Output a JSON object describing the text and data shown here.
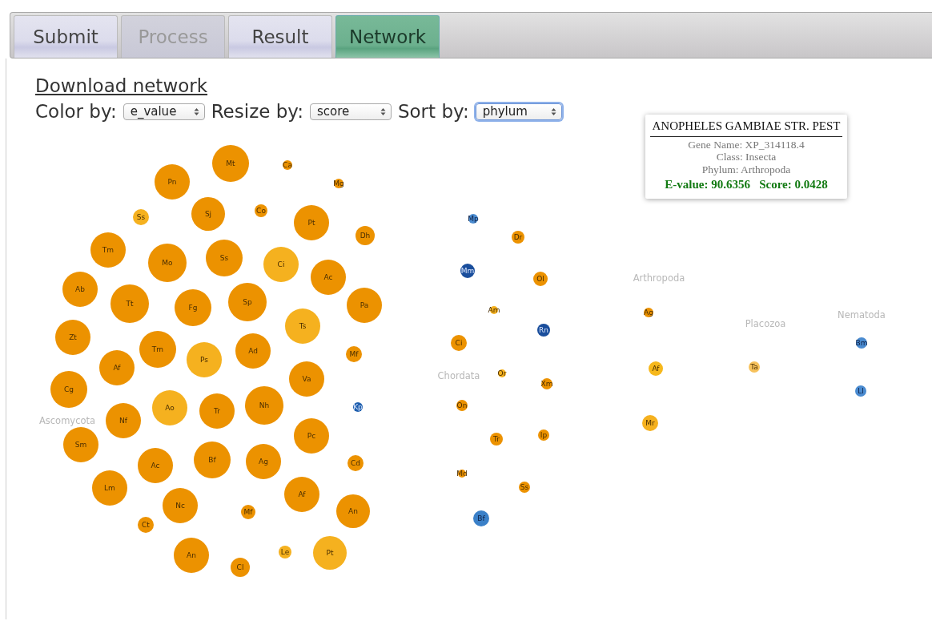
{
  "tabs": [
    {
      "label": "Submit",
      "selected": false,
      "disabled": false
    },
    {
      "label": "Process",
      "selected": false,
      "disabled": true
    },
    {
      "label": "Result",
      "selected": false,
      "disabled": false
    },
    {
      "label": "Network",
      "selected": true,
      "disabled": false
    }
  ],
  "download_link": "Download network",
  "controls": [
    {
      "label": "Color by:",
      "value": "e_value",
      "focused": false
    },
    {
      "label": "Resize by:",
      "value": "score",
      "focused": false
    },
    {
      "label": "Sort by:",
      "value": "phylum",
      "focused": true
    }
  ],
  "groups": [
    {
      "label": "Ascomycota"
    },
    {
      "label": "Chordata"
    },
    {
      "label": "Arthropoda"
    },
    {
      "label": "Placozoa"
    },
    {
      "label": "Nematoda"
    }
  ],
  "nodes": [
    {
      "label": "Mt",
      "color": "#ec9200"
    },
    {
      "label": "Pn",
      "color": "#ec9200"
    },
    {
      "label": "Ca",
      "color": "#ec9200"
    },
    {
      "label": "Mg",
      "color": "#ec9200"
    },
    {
      "label": "Ss",
      "color": "#f5b11f"
    },
    {
      "label": "Sj",
      "color": "#ec9200"
    },
    {
      "label": "Co",
      "color": "#ec9200"
    },
    {
      "label": "Pt",
      "color": "#ec9200"
    },
    {
      "label": "Dh",
      "color": "#ec9200"
    },
    {
      "label": "Tm",
      "color": "#ec9200"
    },
    {
      "label": "Mo",
      "color": "#ec9200"
    },
    {
      "label": "Ss",
      "color": "#ec9200"
    },
    {
      "label": "Ci",
      "color": "#f5b11f"
    },
    {
      "label": "Ac",
      "color": "#ec9200"
    },
    {
      "label": "Ab",
      "color": "#ec9200"
    },
    {
      "label": "Tt",
      "color": "#ec9200"
    },
    {
      "label": "Fg",
      "color": "#ec9200"
    },
    {
      "label": "Sp",
      "color": "#ec9200"
    },
    {
      "label": "Pa",
      "color": "#ec9200"
    },
    {
      "label": "Ts",
      "color": "#f5b11f"
    },
    {
      "label": "Zt",
      "color": "#ec9200"
    },
    {
      "label": "Tm",
      "color": "#ec9200"
    },
    {
      "label": "Ps",
      "color": "#f5b11f"
    },
    {
      "label": "Ad",
      "color": "#ec9200"
    },
    {
      "label": "Mf",
      "color": "#ec9200"
    },
    {
      "label": "Af",
      "color": "#ec9200"
    },
    {
      "label": "Va",
      "color": "#ec9200"
    },
    {
      "label": "Cg",
      "color": "#ec9200"
    },
    {
      "label": "Ao",
      "color": "#f5b11f"
    },
    {
      "label": "Tr",
      "color": "#ec9200"
    },
    {
      "label": "Nh",
      "color": "#ec9200"
    },
    {
      "label": "Kp",
      "color": "#1f5fae"
    },
    {
      "label": "Nf",
      "color": "#ec9200"
    },
    {
      "label": "Pc",
      "color": "#ec9200"
    },
    {
      "label": "Sm",
      "color": "#ec9200"
    },
    {
      "label": "Ac",
      "color": "#ec9200"
    },
    {
      "label": "Bf",
      "color": "#ec9200"
    },
    {
      "label": "Ag",
      "color": "#ec9200"
    },
    {
      "label": "Cd",
      "color": "#ec9200"
    },
    {
      "label": "Lm",
      "color": "#ec9200"
    },
    {
      "label": "Af",
      "color": "#ec9200"
    },
    {
      "label": "Nc",
      "color": "#ec9200"
    },
    {
      "label": "Mf",
      "color": "#ec9200"
    },
    {
      "label": "An",
      "color": "#ec9200"
    },
    {
      "label": "Ct",
      "color": "#ec9200"
    },
    {
      "label": "An",
      "color": "#ec9200"
    },
    {
      "label": "Le",
      "color": "#f5b11f"
    },
    {
      "label": "Pt",
      "color": "#f5b11f"
    },
    {
      "label": "Cl",
      "color": "#ec9200"
    },
    {
      "label": "Mp",
      "color": "#4a8bd0"
    },
    {
      "label": "Dr",
      "color": "#ec9200"
    },
    {
      "label": "Mm",
      "color": "#1a4e9c"
    },
    {
      "label": "Ol",
      "color": "#ec9200"
    },
    {
      "label": "Am",
      "color": "#f5b11f"
    },
    {
      "label": "Rn",
      "color": "#1a4e9c"
    },
    {
      "label": "Ci",
      "color": "#ec9200"
    },
    {
      "label": "Or",
      "color": "#f5b11f"
    },
    {
      "label": "Xm",
      "color": "#ec9200"
    },
    {
      "label": "On",
      "color": "#ec9200"
    },
    {
      "label": "Tr",
      "color": "#ec9200"
    },
    {
      "label": "Ip",
      "color": "#ec9200"
    },
    {
      "label": "Md",
      "color": "#ec9200"
    },
    {
      "label": "Ss",
      "color": "#ec9200"
    },
    {
      "label": "Bf",
      "color": "#3a80c8"
    },
    {
      "label": "Ag",
      "color": "#ec9200"
    },
    {
      "label": "Af",
      "color": "#f6b81c"
    },
    {
      "label": "Mr",
      "color": "#f5b11f"
    },
    {
      "label": "Ta",
      "color": "#f7c25c"
    },
    {
      "label": "Bm",
      "color": "#4a8bd0"
    },
    {
      "label": "Ll",
      "color": "#4a8bd0"
    }
  ],
  "tooltip": {
    "title": "ANOPHELES GAMBIAE STR. PEST",
    "lines": [
      "Gene Name: XP_314118.4",
      "Class: Insecta",
      "Phylum: Arthropoda"
    ],
    "evalue": "E-value: 90.6356",
    "score": "Score: 0.0428"
  }
}
